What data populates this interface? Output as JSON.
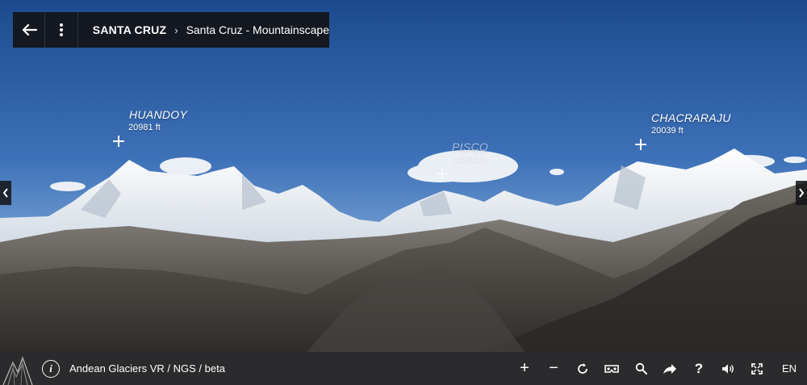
{
  "header": {
    "back_icon": "arrow-left-icon",
    "menu_icon": "vertical-dots-icon",
    "breadcrumb": {
      "location": "SANTA CRUZ",
      "separator": "›",
      "scene": "Santa Cruz - Mountainscape"
    }
  },
  "peaks": [
    {
      "name": "HUANDOY",
      "elevation": "20981 ft"
    },
    {
      "name": "PISCO",
      "elevation": "18901 ft"
    },
    {
      "name": "CHACRARAJU",
      "elevation": "20039 ft"
    }
  ],
  "navigation": {
    "left_icon": "chevron-left-icon",
    "right_icon": "chevron-right-icon"
  },
  "footer": {
    "logo_icon": "mountain-logo-icon",
    "info_label": "i",
    "app_title": "Andean Glaciers VR / NGS / beta",
    "tools": {
      "zoom_in": "+",
      "zoom_out": "−",
      "rotate_icon": "rotate-icon",
      "vr_icon": "vr-headset-icon",
      "search_icon": "search-icon",
      "share_icon": "share-arrow-icon",
      "help": "?",
      "sound_icon": "speaker-icon",
      "fullscreen_icon": "fullscreen-icon",
      "language": "EN"
    }
  },
  "colors": {
    "sky_top": "#1e4f96",
    "sky_horizon": "#7aa6d8",
    "bar": "#2b2b2d",
    "accent": "#ffffff"
  }
}
